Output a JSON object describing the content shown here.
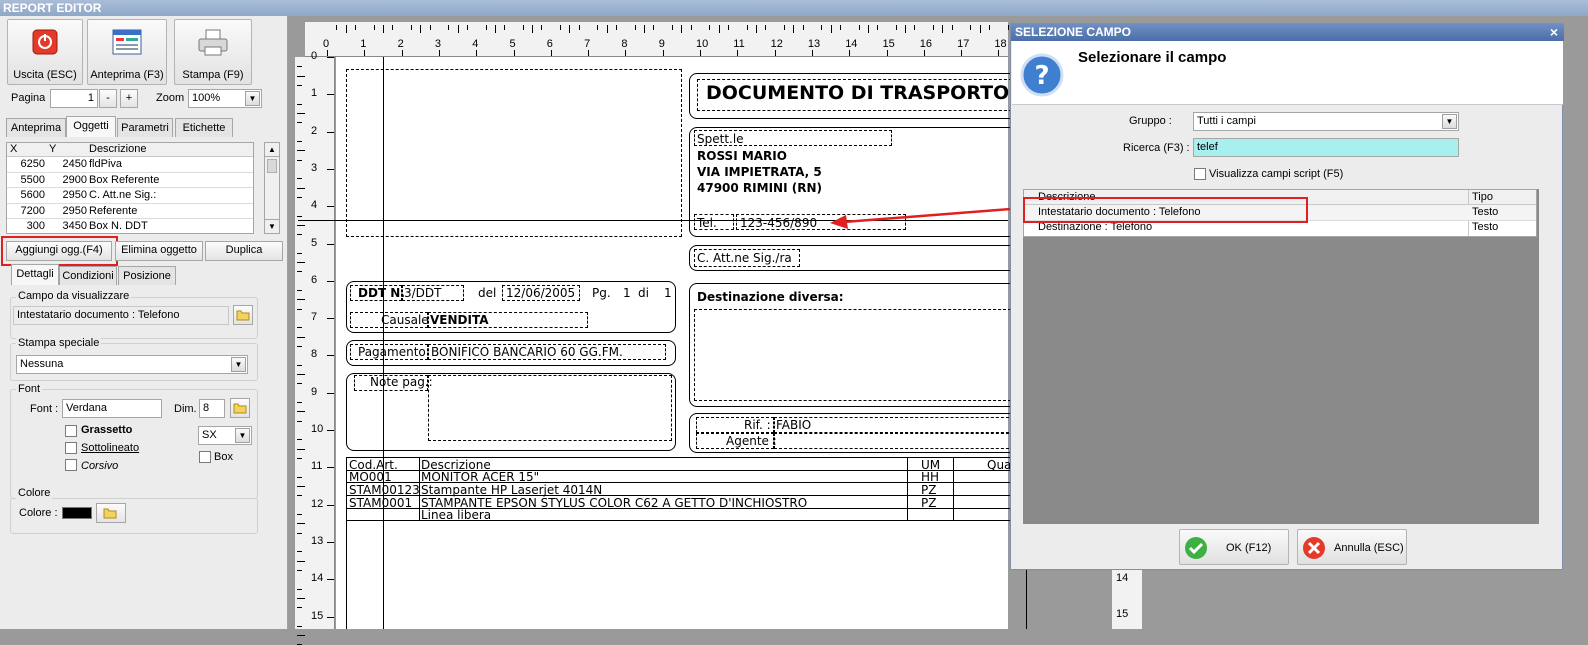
{
  "app": {
    "title": "REPORT EDITOR"
  },
  "toolbar": {
    "exit_label": "Uscita (ESC)",
    "preview_label": "Anteprima (F3)",
    "print_label": "Stampa (F9)",
    "page_label": "Pagina",
    "page_value": "1",
    "minus": "-",
    "plus": "+",
    "zoom_label": "Zoom",
    "zoom_value": "100%"
  },
  "tabs_top": [
    "Anteprima",
    "Oggetti",
    "Parametri",
    "Etichette"
  ],
  "objects_grid": {
    "headers": [
      "X",
      "Y",
      "Descrizione"
    ],
    "rows": [
      {
        "x": "6250",
        "y": "2450",
        "desc": "fldPiva"
      },
      {
        "x": "5500",
        "y": "2900",
        "desc": "Box Referente"
      },
      {
        "x": "5600",
        "y": "2950",
        "desc": "C. Att.ne Sig.:"
      },
      {
        "x": "7200",
        "y": "2950",
        "desc": "Referente"
      },
      {
        "x": "300",
        "y": "3450",
        "desc": "Box N. DDT"
      }
    ]
  },
  "object_buttons": {
    "add": "Aggiungi ogg.(F4)",
    "delete": "Elimina oggetto",
    "duplicate": "Duplica"
  },
  "tabs_bottom": [
    "Dettagli",
    "Condizioni",
    "Posizione"
  ],
  "details": {
    "field_group": "Campo da visualizzare",
    "field_value": "Intestatario documento : Telefono",
    "special_group": "Stampa speciale",
    "special_value": "Nessuna",
    "font_group": "Font",
    "font_label": "Font :",
    "font_value": "Verdana",
    "dim_label": "Dim.",
    "dim_value": "8",
    "bold": "Grassetto",
    "underline": "Sottolineato",
    "italic": "Corsivo",
    "align_value": "SX",
    "box_label": "Box",
    "color_group": "Colore",
    "color_label": "Colore :",
    "color_value": "#000000"
  },
  "ruler": {
    "h": [
      "0",
      "1",
      "2",
      "3",
      "4",
      "5",
      "6",
      "7",
      "8",
      "9",
      "10",
      "11",
      "12",
      "13",
      "14",
      "15",
      "16",
      "17",
      "18"
    ],
    "v": [
      "0",
      "1",
      "2",
      "3",
      "4",
      "5",
      "6",
      "7",
      "8",
      "9",
      "10",
      "11",
      "12",
      "13",
      "14",
      "15"
    ]
  },
  "report": {
    "doc_title": "DOCUMENTO DI TRASPORTO",
    "spett": "Spett.le",
    "name": "ROSSI MARIO",
    "street": "VIA IMPIETRATA, 5",
    "city": "47900 RIMINI (RN)",
    "tel_label": "Tel.",
    "tel_value": "123-456/890",
    "att_label": "C. Att.ne Sig./ra",
    "ddt_label": "DDT N.",
    "ddt_value": "3/DDT",
    "del_label": "del",
    "date_value": "12/06/2005",
    "pg_label": "Pg.",
    "pg_value": "1",
    "di_label": "di",
    "di_value": "1",
    "causale_label": "Causale",
    "causale_value": "VENDITA",
    "pagamento_label": "Pagamento",
    "pagamento_value": "BONIFICO BANCARIO 60 GG.FM.",
    "note_label": "Note pag.:",
    "dest_label": "Destinazione diversa:",
    "rif_label": "Rif. :",
    "rif_value": "FABIO",
    "agente_label": "Agente :",
    "table_headers": [
      "Cod.Art.",
      "Descrizione",
      "UM",
      "Qua"
    ],
    "rows": [
      {
        "code": "MO001",
        "desc": "MONITOR ACER 15\"",
        "um": "HH"
      },
      {
        "code": "STAM00123",
        "desc": "Stampante HP Laserjet 4014N",
        "um": "PZ"
      },
      {
        "code": "STAM0001",
        "desc": "STAMPANTE EPSON STYLUS COLOR C62 A GETTO D'INCHIOSTRO",
        "um": "PZ"
      },
      {
        "code": "",
        "desc": "Linea libera",
        "um": ""
      }
    ]
  },
  "dialog": {
    "title": "SELEZIONE CAMPO",
    "close": "×",
    "heading": "Selezionare il campo",
    "group_label": "Gruppo :",
    "group_value": "Tutti i campi",
    "search_label": "Ricerca (F3) :",
    "search_value": "telef",
    "script_check": "Visualizza campi script (F5)",
    "col_desc": "Descrizione",
    "col_type": "Tipo",
    "rows": [
      {
        "desc": "Intestatario documento : Telefono",
        "type": "Testo"
      },
      {
        "desc": "Destinazione : Telefono",
        "type": "Testo"
      }
    ],
    "ok": "OK (F12)",
    "cancel": "Annulla (ESC)"
  },
  "colors": {
    "highlight": "#e02020",
    "search_bg": "#a8f0f0",
    "dialog_title": "#4a6ea8"
  }
}
